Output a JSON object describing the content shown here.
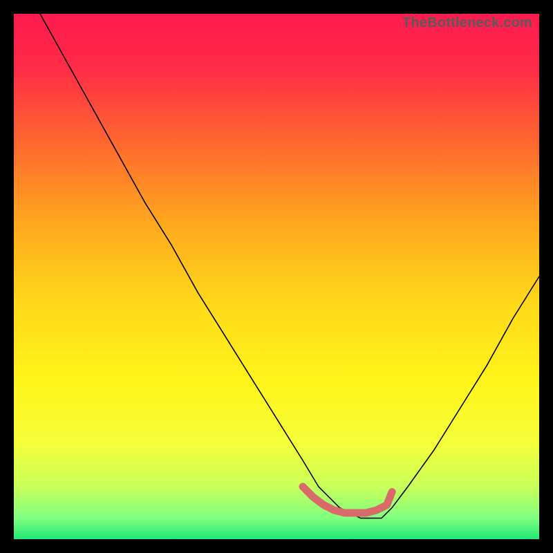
{
  "watermark": "TheBottleneck.com",
  "chart_data": {
    "type": "line",
    "title": "",
    "xlabel": "",
    "ylabel": "",
    "xlim": [
      0,
      100
    ],
    "ylim": [
      0,
      100
    ],
    "grid": false,
    "gradient_stops": [
      {
        "offset": 0.0,
        "color": "#ff1a50"
      },
      {
        "offset": 0.1,
        "color": "#ff2a48"
      },
      {
        "offset": 0.25,
        "color": "#ff6a2e"
      },
      {
        "offset": 0.4,
        "color": "#ffa81e"
      },
      {
        "offset": 0.55,
        "color": "#ffd81a"
      },
      {
        "offset": 0.7,
        "color": "#fff41a"
      },
      {
        "offset": 0.82,
        "color": "#f4ff3a"
      },
      {
        "offset": 0.9,
        "color": "#c8ff5a"
      },
      {
        "offset": 0.96,
        "color": "#80ff80"
      },
      {
        "offset": 1.0,
        "color": "#20e878"
      }
    ],
    "series": [
      {
        "name": "curve",
        "color": "#000000",
        "x": [
          5,
          10,
          15,
          20,
          25,
          30,
          35,
          40,
          45,
          50,
          55,
          58,
          62,
          66,
          70,
          72,
          75,
          80,
          85,
          90,
          95,
          100
        ],
        "y": [
          100,
          91,
          82,
          73,
          64,
          56,
          47,
          39,
          31,
          23,
          15,
          10,
          6,
          4,
          4,
          6,
          10,
          17,
          25,
          33,
          42,
          50
        ]
      }
    ],
    "highlight": {
      "name": "bottom-marker",
      "color": "#d86a6a",
      "x": [
        55,
        57,
        59,
        61,
        63,
        65,
        67,
        69,
        71,
        72
      ],
      "y": [
        10,
        8,
        6.5,
        5.5,
        5,
        5,
        5,
        5.5,
        6.5,
        9
      ]
    }
  }
}
